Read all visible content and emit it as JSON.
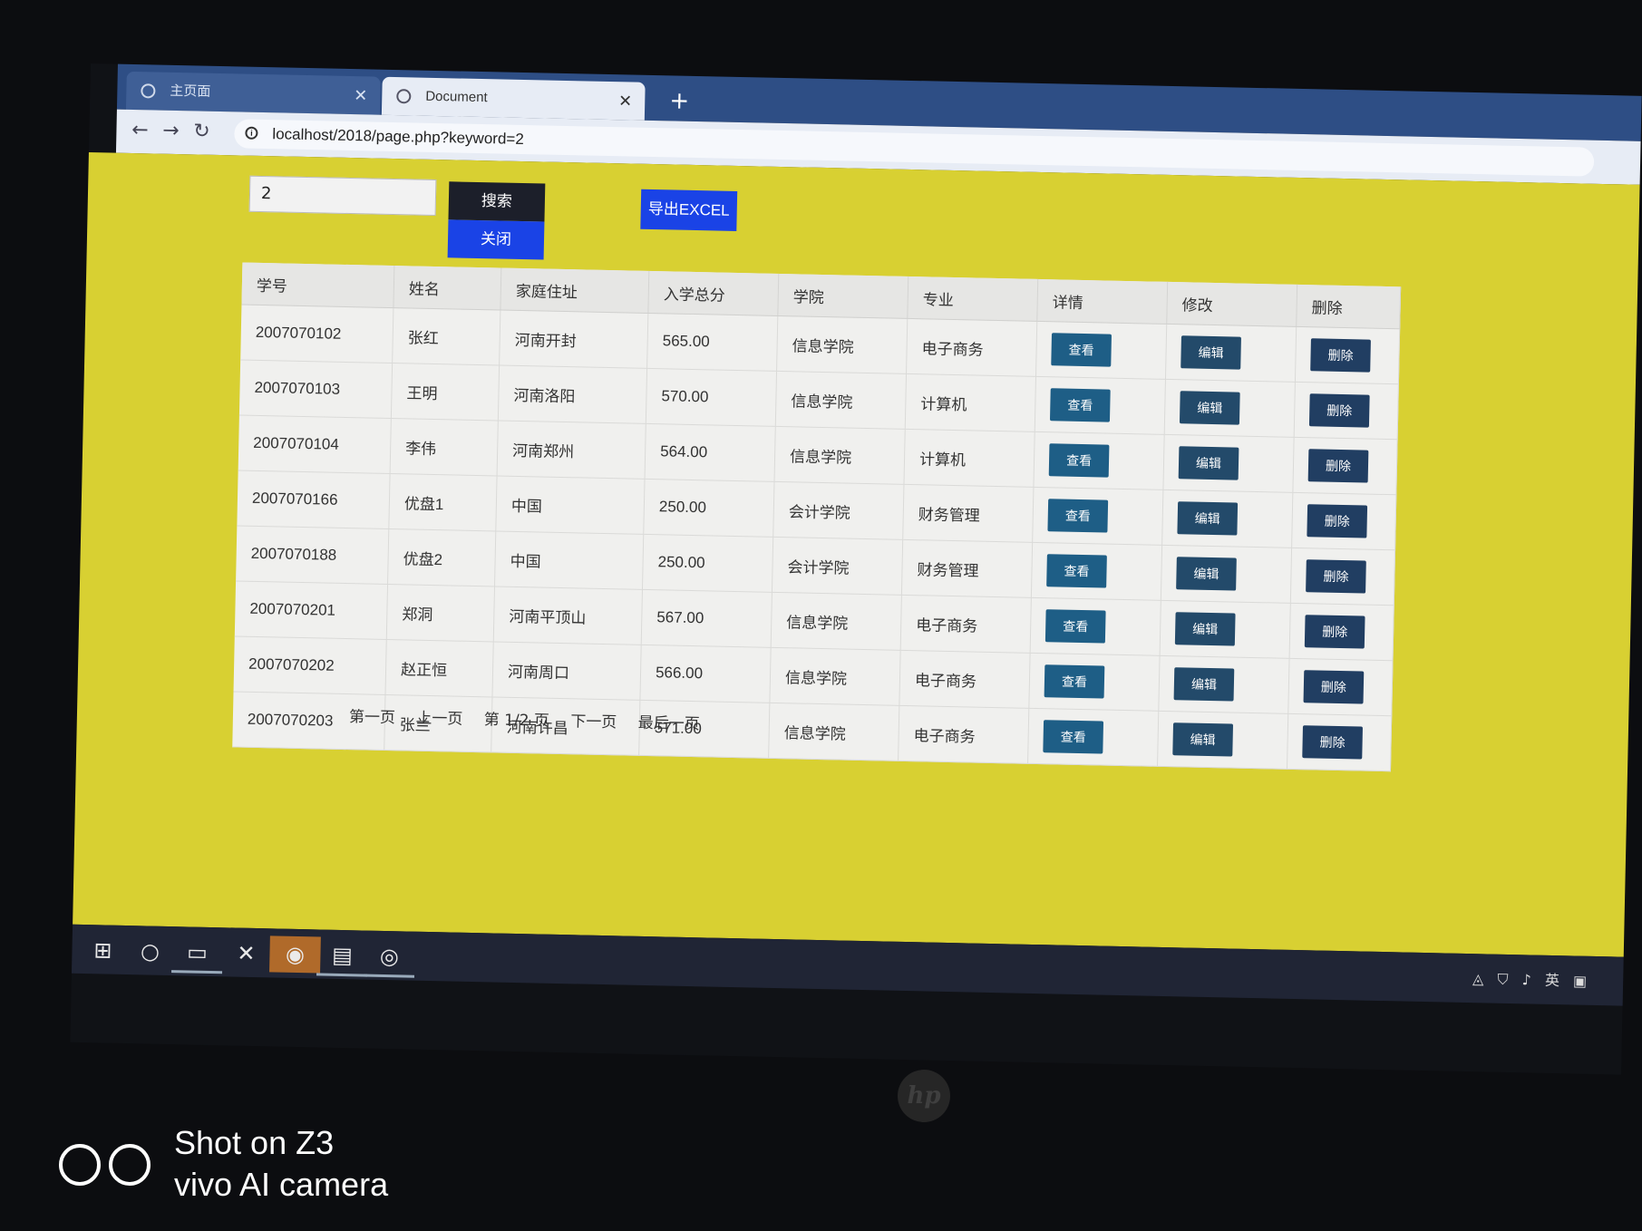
{
  "browser": {
    "tabs": [
      {
        "label": "主页面"
      },
      {
        "label": "Document"
      }
    ],
    "new_tab": "+",
    "url": "localhost/2018/page.php?keyword=2"
  },
  "search": {
    "value": "2"
  },
  "buttons": {
    "search": "搜索",
    "close": "关闭",
    "export": "导出EXCEL"
  },
  "table": {
    "headers": [
      "学号",
      "姓名",
      "家庭住址",
      "入学总分",
      "学院",
      "专业",
      "详情",
      "修改",
      "删除"
    ],
    "action_labels": {
      "view": "查看",
      "edit": "编辑",
      "delete": "删除"
    },
    "rows": [
      {
        "id": "2007070102",
        "name": "张红",
        "address": "河南开封",
        "score": "565.00",
        "college": "信息学院",
        "major": "电子商务"
      },
      {
        "id": "2007070103",
        "name": "王明",
        "address": "河南洛阳",
        "score": "570.00",
        "college": "信息学院",
        "major": "计算机"
      },
      {
        "id": "2007070104",
        "name": "李伟",
        "address": "河南郑州",
        "score": "564.00",
        "college": "信息学院",
        "major": "计算机"
      },
      {
        "id": "2007070166",
        "name": "优盘1",
        "address": "中国",
        "score": "250.00",
        "college": "会计学院",
        "major": "财务管理"
      },
      {
        "id": "2007070188",
        "name": "优盘2",
        "address": "中国",
        "score": "250.00",
        "college": "会计学院",
        "major": "财务管理"
      },
      {
        "id": "2007070201",
        "name": "郑洞",
        "address": "河南平顶山",
        "score": "567.00",
        "college": "信息学院",
        "major": "电子商务"
      },
      {
        "id": "2007070202",
        "name": "赵正恒",
        "address": "河南周口",
        "score": "566.00",
        "college": "信息学院",
        "major": "电子商务"
      },
      {
        "id": "2007070203",
        "name": "张兰",
        "address": "河南许昌",
        "score": "571.00",
        "college": "信息学院",
        "major": "电子商务"
      }
    ]
  },
  "pagination": {
    "first": "第一页",
    "prev": "上一页",
    "current": "第 1/2 页",
    "next": "下一页",
    "last": "最后一页"
  },
  "taskbar": {
    "ime": "英"
  },
  "laptop": {
    "logo": "hp"
  },
  "watermark": {
    "line1": "Shot on Z3",
    "line2": "vivo AI camera"
  },
  "colors": {
    "page_bg": "#d8d032",
    "accent_blue": "#1a43e6",
    "dark_button": "#1c1f2a",
    "action_button": "#1e5e86"
  }
}
